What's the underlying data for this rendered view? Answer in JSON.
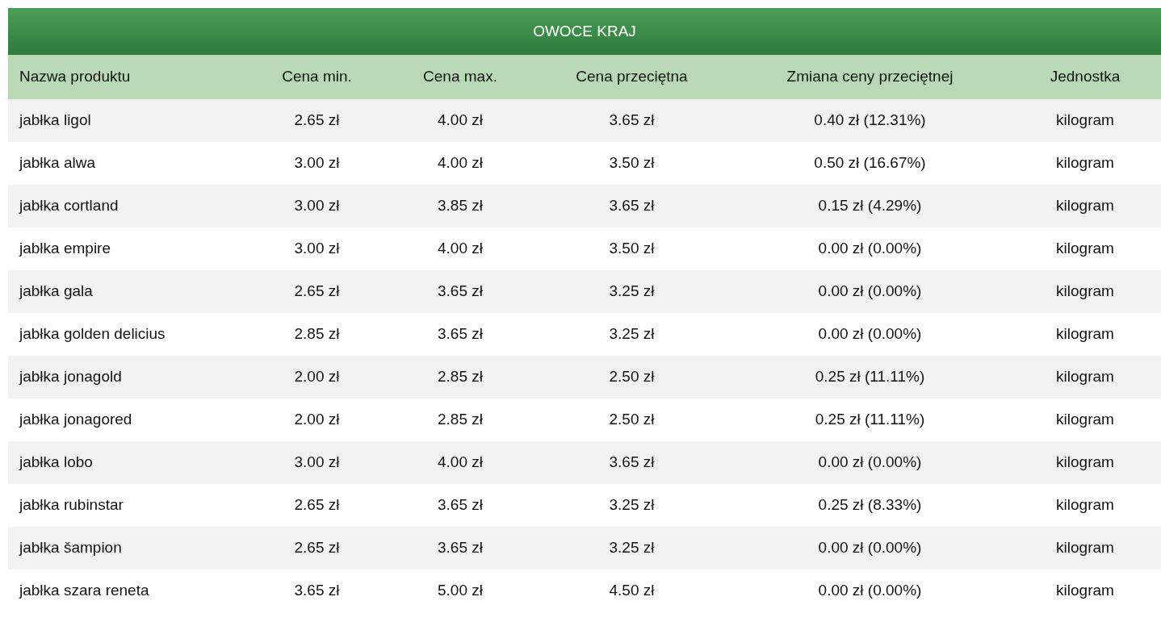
{
  "table": {
    "title": "OWOCE KRAJ",
    "columns": [
      "Nazwa produktu",
      "Cena min.",
      "Cena max.",
      "Cena przeciętna",
      "Zmiana ceny przeciętnej",
      "Jednostka"
    ],
    "rows": [
      [
        "jabłka ligol",
        "2.65 zł",
        "4.00 zł",
        "3.65 zł",
        "0.40 zł (12.31%)",
        "kilogram"
      ],
      [
        "jabłka alwa",
        "3.00 zł",
        "4.00 zł",
        "3.50 zł",
        "0.50 zł (16.67%)",
        "kilogram"
      ],
      [
        "jabłka cortland",
        "3.00 zł",
        "3.85 zł",
        "3.65 zł",
        "0.15 zł (4.29%)",
        "kilogram"
      ],
      [
        "jabłka empire",
        "3.00 zł",
        "4.00 zł",
        "3.50 zł",
        "0.00 zł (0.00%)",
        "kilogram"
      ],
      [
        "jabłka gala",
        "2.65 zł",
        "3.65 zł",
        "3.25 zł",
        "0.00 zł (0.00%)",
        "kilogram"
      ],
      [
        "jabłka golden delicius",
        "2.85 zł",
        "3.65 zł",
        "3.25 zł",
        "0.00 zł (0.00%)",
        "kilogram"
      ],
      [
        "jabłka jonagold",
        "2.00 zł",
        "2.85 zł",
        "2.50 zł",
        "0.25 zł (11.11%)",
        "kilogram"
      ],
      [
        "jabłka jonagored",
        "2.00 zł",
        "2.85 zł",
        "2.50 zł",
        "0.25 zł (11.11%)",
        "kilogram"
      ],
      [
        "jabłka lobo",
        "3.00 zł",
        "4.00 zł",
        "3.65 zł",
        "0.00 zł (0.00%)",
        "kilogram"
      ],
      [
        "jabłka rubinstar",
        "2.65 zł",
        "3.65 zł",
        "3.25 zł",
        "0.25 zł (8.33%)",
        "kilogram"
      ],
      [
        "jabłka šampion",
        "2.65 zł",
        "3.65 zł",
        "3.25 zł",
        "0.00 zł (0.00%)",
        "kilogram"
      ],
      [
        "jabłka szara reneta",
        "3.65 zł",
        "5.00 zł",
        "4.50 zł",
        "0.00 zł (0.00%)",
        "kilogram"
      ]
    ]
  }
}
